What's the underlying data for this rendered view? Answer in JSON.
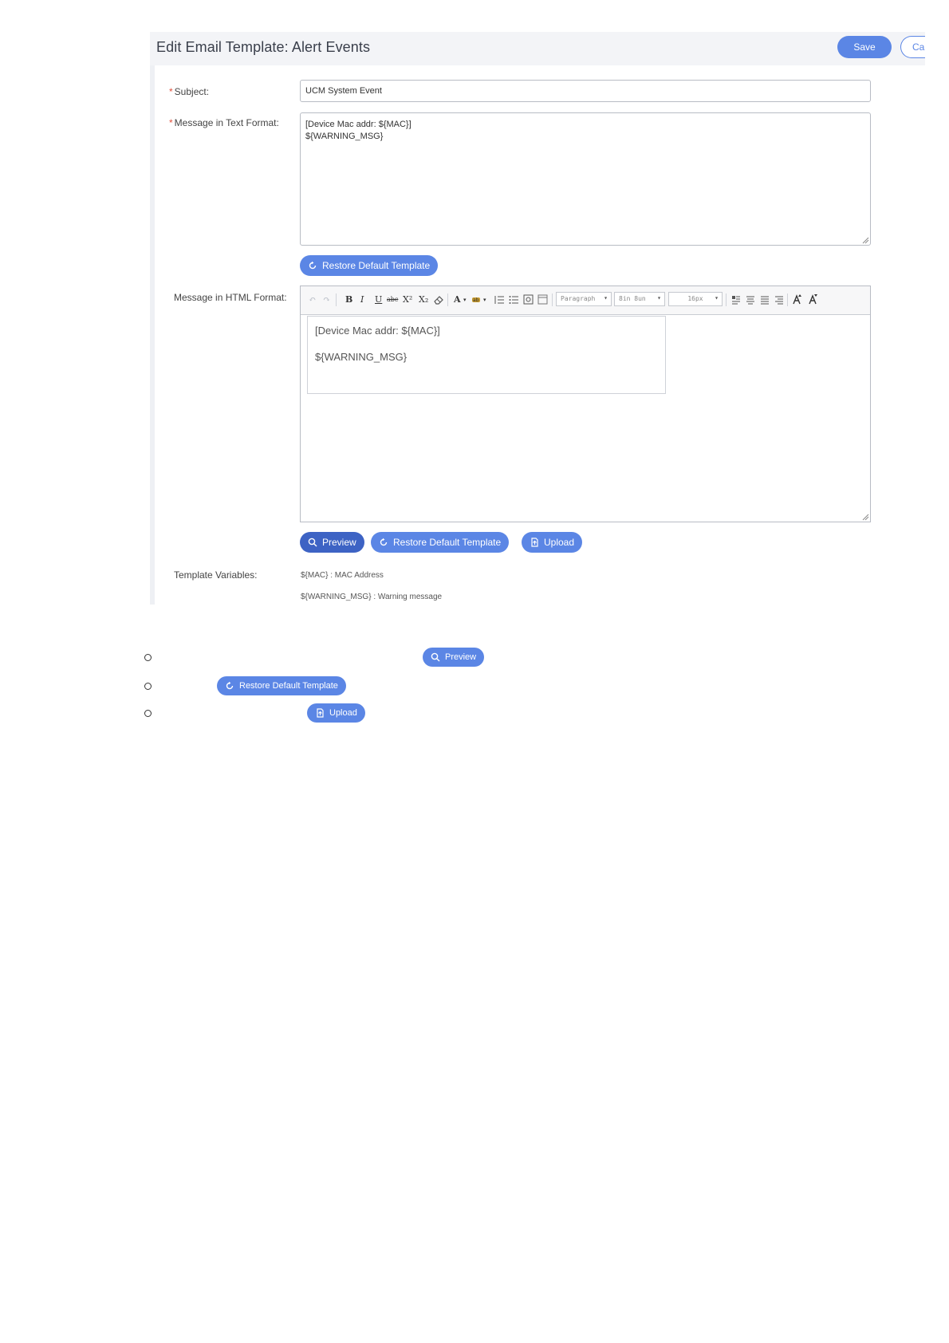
{
  "header": {
    "title": "Edit Email Template: Alert Events",
    "save_label": "Save",
    "cancel_label": "Cancel"
  },
  "form": {
    "subject": {
      "label": "Subject:",
      "value": "UCM System Event"
    },
    "text_message": {
      "label": "Message in Text Format:",
      "lines": [
        "[Device Mac addr: ${MAC}]",
        "${WARNING_MSG}"
      ]
    },
    "restore_label": "Restore Default Template",
    "html_message": {
      "label": "Message in HTML Format:",
      "toolbar": {
        "bold": "B",
        "italic": "I",
        "underline": "U",
        "strike": "abc",
        "superscript": "X²",
        "subscript": "X₂",
        "font_color": "A",
        "paragraph": "Paragraph",
        "font_family": "8in 8un",
        "font_size": "16px"
      },
      "lines": [
        "[Device Mac addr: ${MAC}]",
        "${WARNING_MSG}"
      ]
    },
    "actions": {
      "preview_label": "Preview",
      "restore_label": "Restore Default Template",
      "upload_label": "Upload"
    },
    "template_variables": {
      "label": "Template Variables:",
      "items": [
        "${MAC} : MAC Address",
        "${WARNING_MSG} : Warning message"
      ]
    }
  },
  "legend": {
    "preview_label": "Preview",
    "restore_label": "Restore Default Template",
    "upload_label": "Upload"
  },
  "colors": {
    "accent": "#5b86e5",
    "accent_dark": "#3d63c4",
    "required": "#e0503c",
    "header_bg": "#f3f4f7"
  }
}
